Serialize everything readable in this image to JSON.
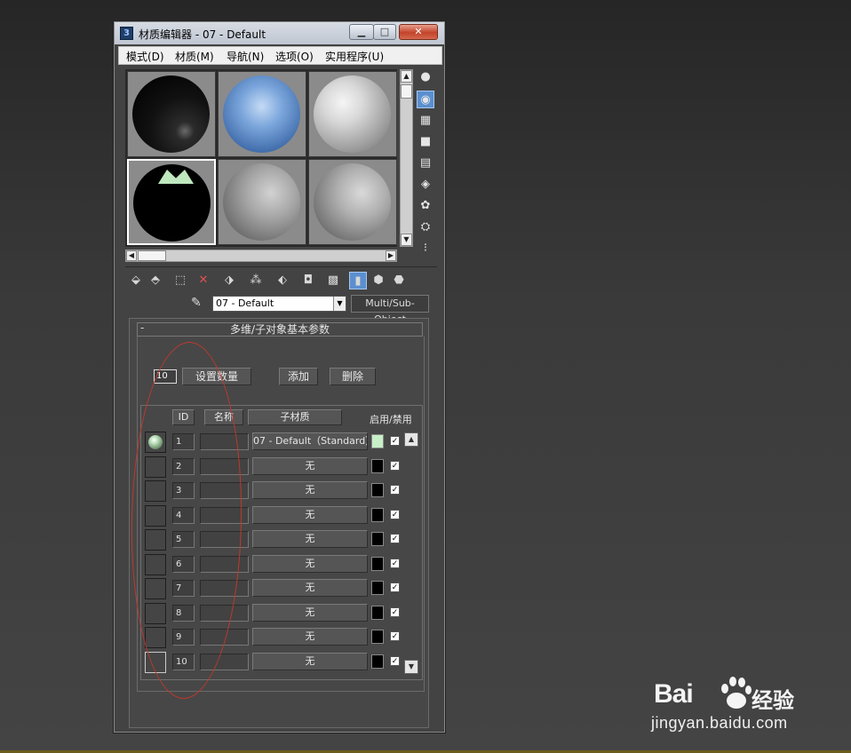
{
  "window": {
    "title": "材质编辑器 - 07 - Default",
    "app_icon": "3",
    "min_label": "▁",
    "max_label": "□",
    "close_label": "✕"
  },
  "menu": [
    "模式(D)",
    "材质(M)",
    "导航(N)",
    "选项(O)",
    "实用程序(U)"
  ],
  "toolbar": {
    "material_name": "07 - Default",
    "multi_label": "Multi/Sub-Object"
  },
  "rollout": {
    "collapse": "-",
    "title": "多维/子对象基本参数",
    "count": "10",
    "set_count_label": "设置数量",
    "add_label": "添加",
    "delete_label": "删除"
  },
  "table": {
    "headers": {
      "id": "ID",
      "name": "名称",
      "sub_material": "子材质",
      "toggle": "启用/禁用"
    },
    "rows": [
      {
        "id": "1",
        "name": "",
        "sub": "07 - Default（Standard）",
        "color": "#c8f0c8",
        "enabled": "✓"
      },
      {
        "id": "2",
        "name": "",
        "sub": "无",
        "color": "#000000",
        "enabled": "✓"
      },
      {
        "id": "3",
        "name": "",
        "sub": "无",
        "color": "#000000",
        "enabled": "✓"
      },
      {
        "id": "4",
        "name": "",
        "sub": "无",
        "color": "#000000",
        "enabled": "✓"
      },
      {
        "id": "5",
        "name": "",
        "sub": "无",
        "color": "#000000",
        "enabled": "✓"
      },
      {
        "id": "6",
        "name": "",
        "sub": "无",
        "color": "#000000",
        "enabled": "✓"
      },
      {
        "id": "7",
        "name": "",
        "sub": "无",
        "color": "#000000",
        "enabled": "✓"
      },
      {
        "id": "8",
        "name": "",
        "sub": "无",
        "color": "#000000",
        "enabled": "✓"
      },
      {
        "id": "9",
        "name": "",
        "sub": "无",
        "color": "#000000",
        "enabled": "✓"
      },
      {
        "id": "10",
        "name": "",
        "sub": "无",
        "color": "#000000",
        "enabled": "✓"
      }
    ]
  },
  "watermark": {
    "brand": "Bai",
    "brand_cn": "经验",
    "url": "jingyan.baidu.com"
  },
  "colors": {
    "accent_active": "#5b8fcf",
    "annotation": "#c0392b"
  }
}
